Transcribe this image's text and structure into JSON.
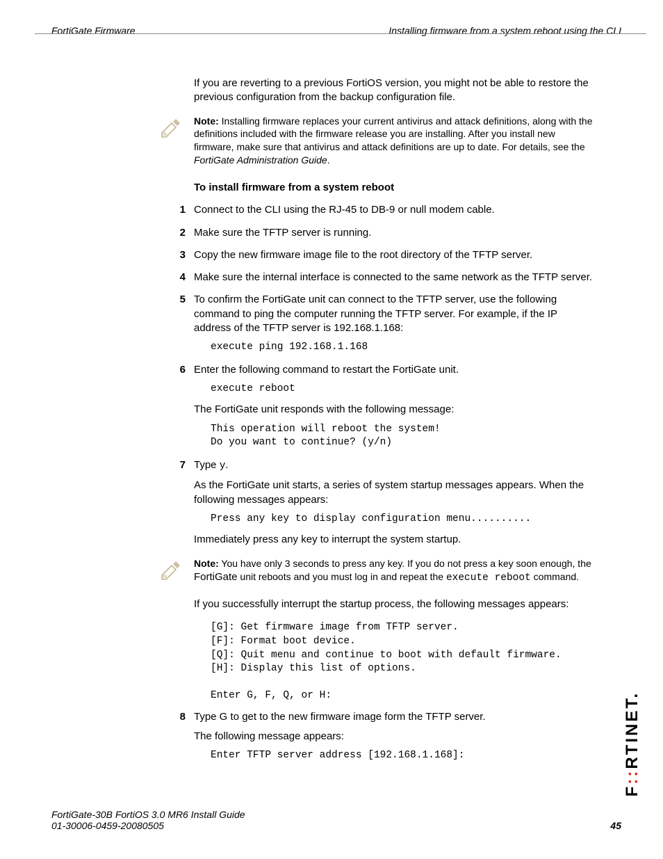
{
  "header": {
    "left": "FortiGate Firmware",
    "right": "Installing firmware from a system reboot using the CLI"
  },
  "intro_para": "If you are reverting to a previous FortiOS version, you might not be able to restore the previous configuration from the backup configuration file.",
  "note1": {
    "label": "Note:",
    "text": " Installing firmware replaces your current antivirus and attack definitions, along with the definitions included with the firmware release you are installing. After you install new firmware, make sure that antivirus and attack definitions are up to date. For details, see the ",
    "italic": "FortiGate Administration Guide",
    "tail": "."
  },
  "section_heading": "To install firmware from a system reboot",
  "steps": {
    "s1": {
      "num": "1",
      "text": "Connect to the CLI using the RJ-45 to DB-9 or null modem cable."
    },
    "s2": {
      "num": "2",
      "text": "Make sure the TFTP server is running."
    },
    "s3": {
      "num": "3",
      "text": "Copy the new firmware image file to the root directory of the TFTP server."
    },
    "s4": {
      "num": "4",
      "text": "Make sure the internal interface is connected to the same network as the TFTP server."
    },
    "s5": {
      "num": "5",
      "text": "To confirm the FortiGate unit can connect to the TFTP server, use the following command to ping the computer running the TFTP server. For example, if the IP address of the TFTP server is 192.168.1.168:",
      "code": "execute ping 192.168.1.168"
    },
    "s6": {
      "num": "6",
      "text": "Enter the following command to restart the FortiGate unit.",
      "code": "execute reboot",
      "after": "The FortiGate unit responds with the following message:",
      "code2": "This operation will reboot the system!\nDo you want to continue? (y/n)"
    },
    "s7": {
      "num": "7",
      "lead": "Type ",
      "lead_code": "y",
      "lead_tail": ".",
      "p1": "As the FortiGate unit starts, a series of system startup messages appears. When the following messages appears:",
      "code": "Press any key to display configuration menu..........",
      "p2": "Immediately press any key to interrupt the system startup."
    },
    "s8": {
      "num": "8",
      "text": "Type G to get to the new firmware image form the TFTP server.",
      "p1": "The following message appears:",
      "code": "Enter TFTP server address [192.168.1.168]:"
    }
  },
  "note2": {
    "label": "Note:",
    "t1": " You have only 3 seconds to press any key. If you do not press a key soon enough, the ",
    "prod": "FortiGate",
    "t2": " unit reboots and you must log in and repeat the ",
    "cmd": "execute reboot",
    "t3": " command."
  },
  "after_note2": "If you successfully interrupt the startup process, the following messages appears:",
  "menu_code": "[G]: Get firmware image from TFTP server.\n[F]: Format boot device.\n[Q]: Quit menu and continue to boot with default firmware.\n[H]: Display this list of options.\n\nEnter G, F, Q, or H:",
  "footer": {
    "line1": "FortiGate-30B FortiOS 3.0 MR6 Install Guide",
    "line2": "01-30006-0459-20080505",
    "page": "45"
  },
  "brand": {
    "pre": "F",
    "accent": "::",
    "post": "RTINET."
  }
}
